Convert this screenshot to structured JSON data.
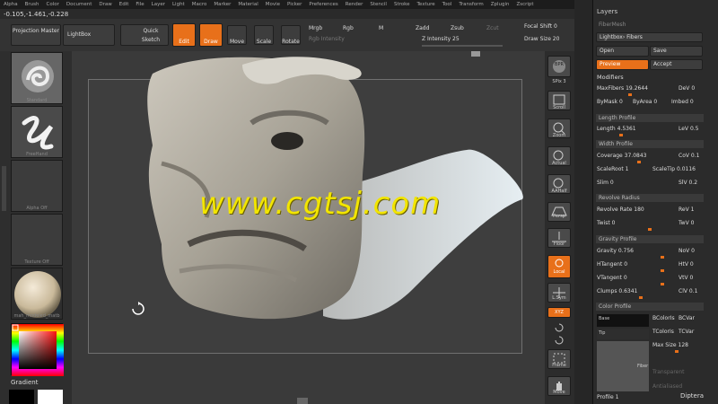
{
  "menu": [
    "Alpha",
    "Brush",
    "Color",
    "Document",
    "Draw",
    "Edit",
    "File",
    "Layer",
    "Light",
    "Macro",
    "Marker",
    "Material",
    "Movie",
    "Picker",
    "Preferences",
    "Render",
    "Stencil",
    "Stroke",
    "Texture",
    "Tool",
    "Transform",
    "Zplugin",
    "Zscript"
  ],
  "coords": "-0.105,-1.461,-0.228",
  "shelf": {
    "projection_master": "Projection Master",
    "lightbox": "LightBox",
    "quick_sketch": "Quick Sketch",
    "edit": "Edit",
    "draw": "Draw",
    "move": "Move",
    "scale": "Scale",
    "rotate": "Rotate",
    "mrgb": "Mrgb",
    "rgb": "Rgb",
    "m": "M",
    "rgb_intensity": "Rgb Intensity",
    "zadd": "Zadd",
    "zsub": "Zsub",
    "zcut": "Zcut",
    "z_intensity": "Z Intensity 25",
    "focal_shift": "Focal Shift 0",
    "draw_size": "Draw Size 20"
  },
  "left": {
    "standard": "Standard",
    "freehand": "FreeHand",
    "alpha_off": "Alpha Off",
    "texture_off": "Texture Off",
    "material": "mah_modeled_matb",
    "gradient": "Gradient"
  },
  "watermark": "www.cgtsj.com",
  "right_tools": {
    "bpr": "BPR",
    "spix": "SPix 3",
    "scroll": "Scroll",
    "zoom": "Zoom",
    "actual": "Actual",
    "aahalf": "AAHalf",
    "persp": "Persp",
    "floor": "Floor",
    "local": "Local",
    "lsym": "L.Sym",
    "xyz": "XYZ",
    "frame": "Frame",
    "move": "Move"
  },
  "palette": {
    "layers": "Layers",
    "fibermesh": "FiberMesh",
    "lightbox_fibers": "Lightbox› Fibers",
    "open": "Open",
    "save": "Save",
    "preview": "Preview",
    "accept": "Accept",
    "modifiers": "Modifiers",
    "maxfibers": "MaxFibers 19.2644",
    "dev": "DeV 0",
    "bymask": "ByMask 0",
    "byarea": "ByArea 0",
    "imbed": "Imbed 0",
    "length_profile": "Length Profile",
    "length": "Length 4.5361",
    "lev": "LeV 0.5",
    "width_profile": "Width Profile",
    "coverage": "Coverage 37.0843",
    "cov": "CoV 0.1",
    "scaleroot": "ScaleRoot 1",
    "scaletip": "ScaleTip 0.0116",
    "slim": "Slim 0",
    "slv": "SlV 0.2",
    "revolve_radius": "Revolve Radius",
    "revolve_rate": "Revolve Rate 180",
    "rev": "ReV 1",
    "twist": "Twist 0",
    "twv": "TwV 0",
    "gravity_profile": "Gravity Profile",
    "gravity": "Gravity 0.756",
    "nov": "NoV 0",
    "htangent": "HTangent 0",
    "htv": "HtV 0",
    "vtangent": "VTangent 0",
    "vtv": "VtV 0",
    "clumps": "Clumps 0.6341",
    "clv": "ClV 0.1",
    "color_profile": "Color Profile",
    "base": "Base",
    "tip": "Tip",
    "bcolor": "BColorIs",
    "bcvar": "BCVar",
    "tcolor": "TColorIs",
    "tcvar": "TCVar",
    "max_size": "Max Size 128",
    "transparent": "Transparent",
    "antialiased": "Antialiased",
    "fiber": "Fiber",
    "profile": "Profile 1",
    "diptera": "Diptera"
  },
  "colors": {
    "accent": "#e8701a",
    "watermark": "#f2e500"
  }
}
